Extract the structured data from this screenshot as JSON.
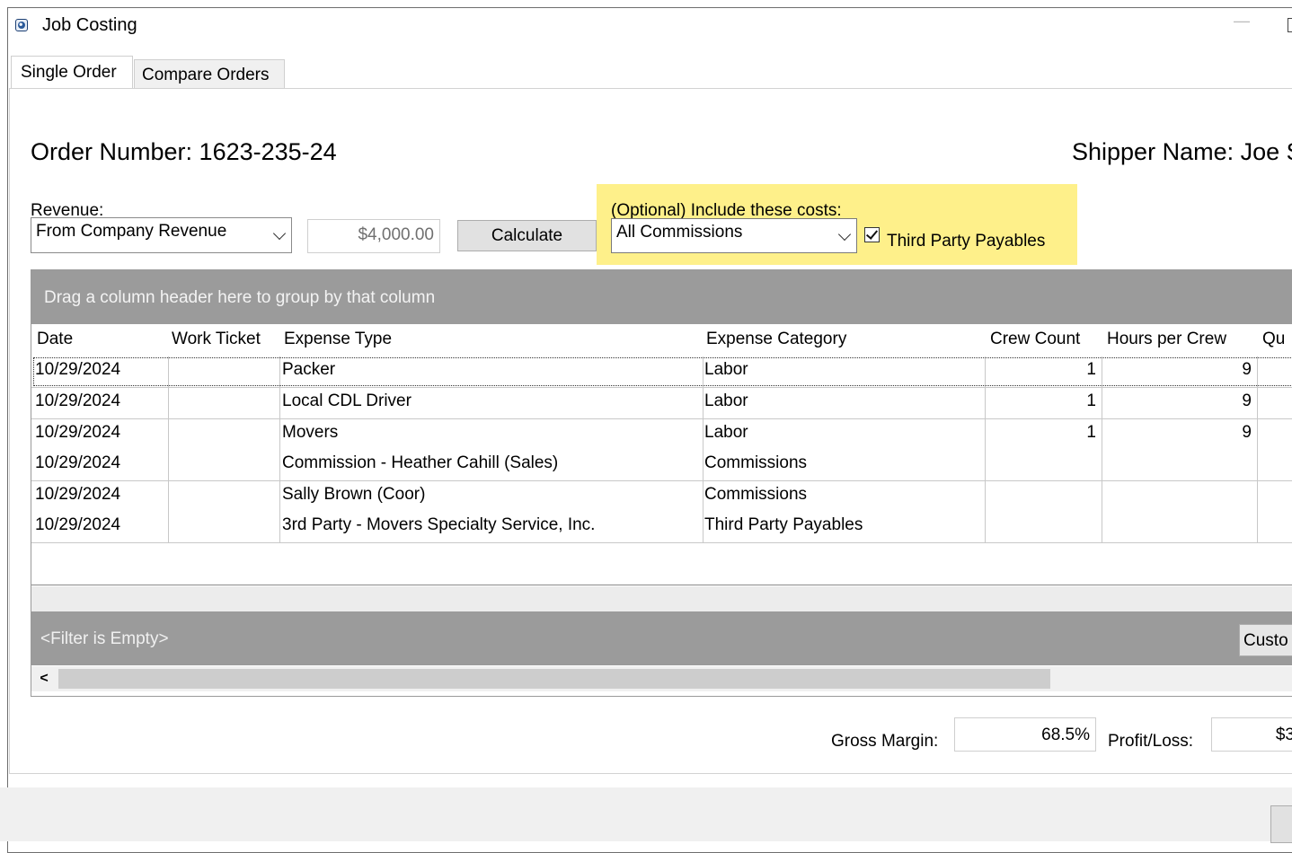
{
  "window": {
    "title": "Job Costing"
  },
  "tabs": {
    "single_order": "Single Order",
    "compare_orders": "Compare Orders"
  },
  "order": {
    "number_text": "Order Number: 1623-235-24",
    "shipper_text": "Shipper Name: Joe S"
  },
  "revenue": {
    "label": "Revenue:",
    "source_selected": "From Company Revenue",
    "amount": "$4,000.00",
    "calculate_label": "Calculate"
  },
  "optional_costs": {
    "label": "(Optional) Include these costs:",
    "selected": "All Commissions",
    "third_party_label": "Third Party Payables",
    "third_party_checked": true
  },
  "grid": {
    "group_hint": "Drag a column header here to group by that column",
    "columns": [
      "Date",
      "Work Ticket",
      "Expense Type",
      "Expense Category",
      "Crew Count",
      "Hours per Crew",
      "Qu"
    ],
    "rows": [
      {
        "date": "10/29/2024",
        "work_ticket": "",
        "expense_type": "Packer",
        "expense_category": "Labor",
        "crew_count": "1",
        "hours_per_crew": "9",
        "qty": ""
      },
      {
        "date": "10/29/2024",
        "work_ticket": "",
        "expense_type": "Local CDL Driver",
        "expense_category": "Labor",
        "crew_count": "1",
        "hours_per_crew": "9",
        "qty": ""
      },
      {
        "date": "10/29/2024",
        "work_ticket": "",
        "expense_type": "Movers",
        "expense_category": "Labor",
        "crew_count": "1",
        "hours_per_crew": "9",
        "qty": ""
      },
      {
        "date": "10/29/2024",
        "work_ticket": "",
        "expense_type": "Commission - Heather Cahill (Sales)",
        "expense_category": "Commissions",
        "crew_count": "",
        "hours_per_crew": "",
        "qty": ""
      },
      {
        "date": "10/29/2024",
        "work_ticket": "",
        "expense_type": "Sally Brown (Coor)",
        "expense_category": "Commissions",
        "crew_count": "",
        "hours_per_crew": "",
        "qty": ""
      },
      {
        "date": "10/29/2024",
        "work_ticket": "",
        "expense_type": "3rd Party - Movers Specialty Service, Inc.",
        "expense_category": "Third Party Payables",
        "crew_count": "",
        "hours_per_crew": "",
        "qty": ""
      }
    ],
    "filter_text": "<Filter is Empty>",
    "customize_label": "Custo",
    "scroll_left_glyph": "<"
  },
  "summary": {
    "gross_margin_label": "Gross Margin:",
    "gross_margin_value": "68.5%",
    "profit_loss_label": "Profit/Loss:",
    "profit_loss_value": "$3"
  },
  "colors": {
    "highlight": "#fef08a",
    "grid_bar": "#9b9b9b"
  }
}
